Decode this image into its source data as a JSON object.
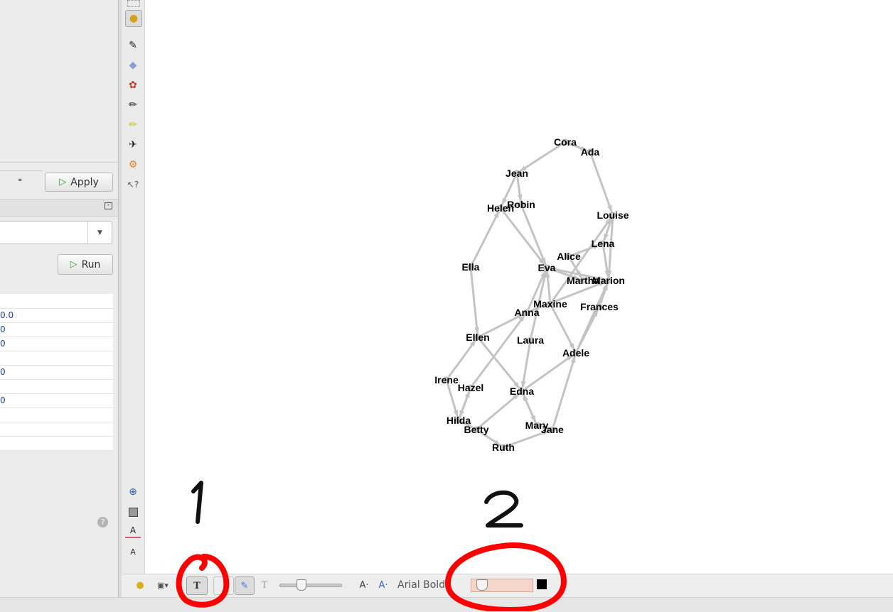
{
  "left_panel": {
    "apply_label": "Apply",
    "run_label": "Run",
    "table_values": [
      "",
      "0.0",
      "0",
      "0",
      "",
      "0",
      "",
      "0",
      "",
      "",
      ""
    ]
  },
  "bottom_toolbar": {
    "font_name": "Arial Bold"
  },
  "graph": {
    "nodes": [
      "Cora",
      "Ada",
      "Jean",
      "Robin",
      "Helen",
      "Louise",
      "Lena",
      "Alice",
      "Eva",
      "Martha",
      "Marion",
      "Ella",
      "Maxine",
      "Anna",
      "Frances",
      "Ellen",
      "Laura",
      "Adele",
      "Irene",
      "Hazel",
      "Edna",
      "Hilda",
      "Betty",
      "Mary",
      "Jane",
      "Ruth"
    ]
  },
  "annotations": {
    "label_1": "1",
    "label_2": "2",
    "accent_color": "#ff0000"
  }
}
